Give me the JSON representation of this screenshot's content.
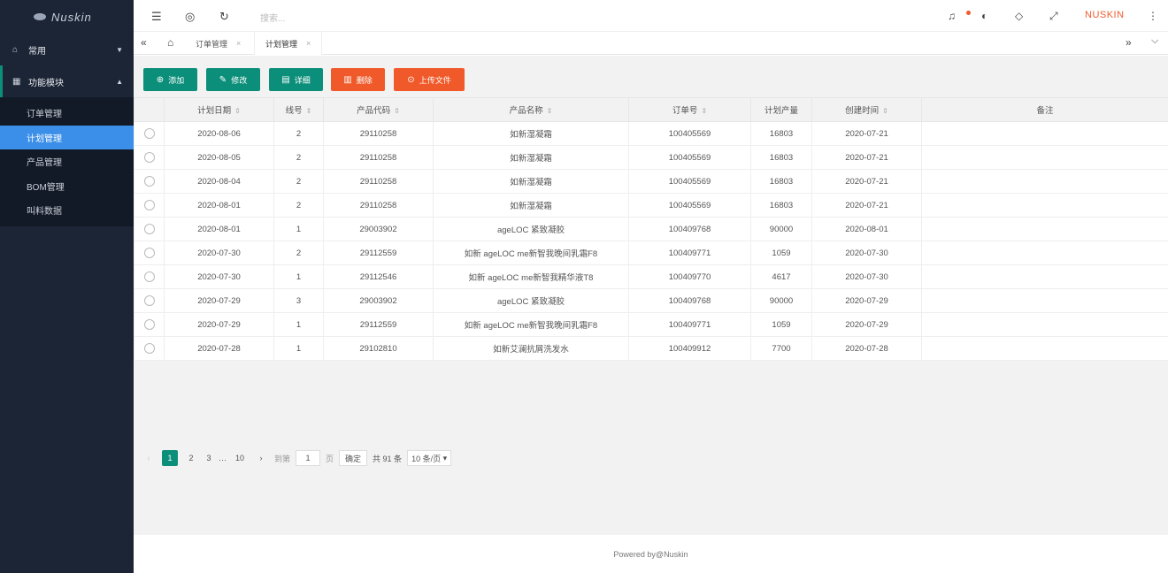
{
  "sidebar": {
    "logo_text": "Nuskin",
    "groups": [
      {
        "label": "常用",
        "icon": "home-icon",
        "expanded": false
      },
      {
        "label": "功能模块",
        "icon": "grid-icon",
        "expanded": true
      }
    ],
    "items": [
      {
        "label": "订单管理",
        "active": false
      },
      {
        "label": "计划管理",
        "active": true
      },
      {
        "label": "产品管理",
        "active": false
      },
      {
        "label": "BOM管理",
        "active": false
      },
      {
        "label": "叫料数据",
        "active": false
      }
    ]
  },
  "topbar": {
    "search_placeholder": "搜索...",
    "brand": "NUSKIN"
  },
  "tabs": [
    {
      "label": "订单管理",
      "active": false
    },
    {
      "label": "计划管理",
      "active": true
    }
  ],
  "toolbar": {
    "add": "添加",
    "edit": "修改",
    "detail": "详细",
    "delete": "删除",
    "upload": "上传文件"
  },
  "table": {
    "columns": [
      "计划日期",
      "线号",
      "产品代码",
      "产品名称",
      "订单号",
      "计划产量",
      "创建时间",
      "备注"
    ],
    "rows": [
      [
        "2020-08-06",
        "2",
        "29110258",
        "如新湿凝霜",
        "100405569",
        "16803",
        "2020-07-21",
        ""
      ],
      [
        "2020-08-05",
        "2",
        "29110258",
        "如新湿凝霜",
        "100405569",
        "16803",
        "2020-07-21",
        ""
      ],
      [
        "2020-08-04",
        "2",
        "29110258",
        "如新湿凝霜",
        "100405569",
        "16803",
        "2020-07-21",
        ""
      ],
      [
        "2020-08-01",
        "2",
        "29110258",
        "如新湿凝霜",
        "100405569",
        "16803",
        "2020-07-21",
        ""
      ],
      [
        "2020-08-01",
        "1",
        "29003902",
        "ageLOC 紧致凝胶",
        "100409768",
        "90000",
        "2020-08-01",
        ""
      ],
      [
        "2020-07-30",
        "2",
        "29112559",
        "如新 ageLOC me新智我晚间乳霜F8",
        "100409771",
        "1059",
        "2020-07-30",
        ""
      ],
      [
        "2020-07-30",
        "1",
        "29112546",
        "如新 ageLOC me新智我精华液T8",
        "100409770",
        "4617",
        "2020-07-30",
        ""
      ],
      [
        "2020-07-29",
        "3",
        "29003902",
        "ageLOC 紧致凝胶",
        "100409768",
        "90000",
        "2020-07-29",
        ""
      ],
      [
        "2020-07-29",
        "1",
        "29112559",
        "如新 ageLOC me新智我晚间乳霜F8",
        "100409771",
        "1059",
        "2020-07-29",
        ""
      ],
      [
        "2020-07-28",
        "1",
        "29102810",
        "如新艾澜抗屑洗发水",
        "100409912",
        "7700",
        "2020-07-28",
        ""
      ]
    ]
  },
  "pagination": {
    "pages": [
      "1",
      "2",
      "3",
      "…",
      "10"
    ],
    "current": "1",
    "goto_label": "到第",
    "goto_value": "1",
    "page_unit": "页",
    "confirm": "确定",
    "total": "共 91 条",
    "page_size": "10 条/页"
  },
  "footer": {
    "text": "Powered by@Nuskin"
  },
  "colors": {
    "primary": "#0c8f7a",
    "danger": "#f05a2a",
    "sidebar": "#1c2536",
    "active_item": "#3c8fe8"
  }
}
